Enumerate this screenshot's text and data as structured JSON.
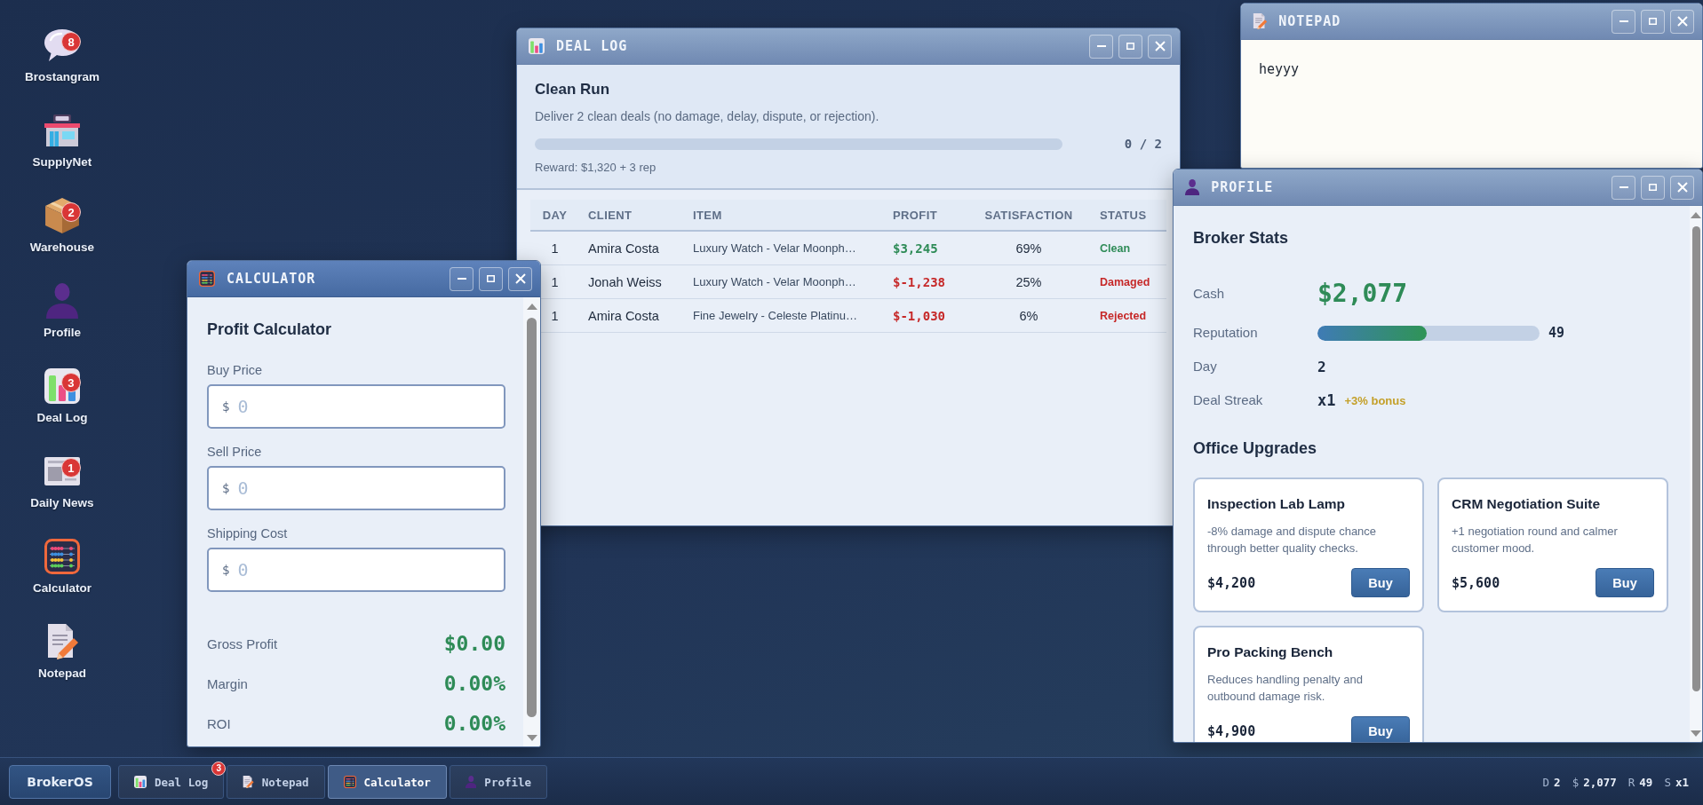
{
  "desktop_icons": [
    {
      "label": "Brostangram",
      "badge": "8"
    },
    {
      "label": "SupplyNet"
    },
    {
      "label": "Warehouse",
      "badge": "2"
    },
    {
      "label": "Profile"
    },
    {
      "label": "Deal Log",
      "badge": "3"
    },
    {
      "label": "Daily News",
      "badge": "1"
    },
    {
      "label": "Calculator"
    },
    {
      "label": "Notepad"
    }
  ],
  "deal_log_window": {
    "title": "DEAL LOG",
    "active": false,
    "goal": {
      "title": "Clean Run",
      "description": "Deliver 2 clean deals (no damage, delay, dispute, or rejection).",
      "progress": "0 / 2",
      "reward": "Reward: $1,320 + 3 rep"
    },
    "table": {
      "columns": [
        "DAY",
        "CLIENT",
        "ITEM",
        "PROFIT",
        "SATISFACTION",
        "STATUS"
      ],
      "rows": [
        {
          "day": "1",
          "client": "Amira Costa",
          "item": "Luxury Watch - Velar Moonph…",
          "profit": {
            "text": "$3,245",
            "color": "#2e8b57"
          },
          "satisfaction": "69%",
          "status": {
            "text": "Clean",
            "color": "#2e8b57"
          }
        },
        {
          "day": "1",
          "client": "Jonah Weiss",
          "item": "Luxury Watch - Velar Moonph…",
          "profit": {
            "text": "$-1,238",
            "color": "#c62828"
          },
          "satisfaction": "25%",
          "status": {
            "text": "Damaged",
            "color": "#c62828"
          }
        },
        {
          "day": "1",
          "client": "Amira Costa",
          "item": "Fine Jewelry - Celeste Platinu…",
          "profit": {
            "text": "$-1,030",
            "color": "#c62828"
          },
          "satisfaction": "6%",
          "status": {
            "text": "Rejected",
            "color": "#c62828"
          }
        }
      ]
    }
  },
  "calculator_window": {
    "title": "CALCULATOR",
    "active": true,
    "heading": "Profit Calculator",
    "fields": [
      {
        "label": "Buy Price",
        "prefix": "$",
        "placeholder": "0"
      },
      {
        "label": "Sell Price",
        "prefix": "$",
        "placeholder": "0"
      },
      {
        "label": "Shipping Cost",
        "prefix": "$",
        "placeholder": "0"
      }
    ],
    "results": [
      {
        "label": "Gross Profit",
        "value": "$0.00"
      },
      {
        "label": "Margin",
        "value": "0.00%"
      },
      {
        "label": "ROI",
        "value": "0.00%"
      }
    ]
  },
  "notepad_window": {
    "title": "NOTEPAD",
    "active": false,
    "text": "heyyy"
  },
  "profile_window": {
    "title": "PROFILE",
    "active": false,
    "heading": "Broker Stats",
    "stats": [
      {
        "kind": "cash",
        "label": "Cash",
        "value": "$2,077"
      },
      {
        "kind": "meter",
        "label": "Reputation",
        "level": 0.49,
        "value": "49"
      },
      {
        "kind": "plain",
        "label": "Day",
        "value": "2"
      },
      {
        "kind": "streak",
        "label": "Deal Streak",
        "value": "x1",
        "bonus": "+3% bonus"
      }
    ],
    "upgrades_heading": "Office Upgrades",
    "upgrades": [
      {
        "name": "Inspection Lab Lamp",
        "description": "-8% damage and dispute chance through better quality checks.",
        "price": "$4,200",
        "button": "Buy"
      },
      {
        "name": "CRM Negotiation Suite",
        "description": "+1 negotiation round and calmer customer mood.",
        "price": "$5,600",
        "button": "Buy"
      },
      {
        "name": "Pro Packing Bench",
        "description": "Reduces handling penalty and outbound damage risk.",
        "price": "$4,900",
        "button": "Buy"
      }
    ]
  },
  "taskbar": {
    "start_button": "BrokerOS",
    "items": [
      {
        "label": "Deal Log",
        "badge": "3",
        "selected": false
      },
      {
        "label": "Notepad",
        "selected": false
      },
      {
        "label": "Calculator",
        "selected": true
      },
      {
        "label": "Profile",
        "selected": false
      }
    ],
    "status": [
      {
        "label": "D",
        "value": "2"
      },
      {
        "label": "$",
        "value": "2,077"
      },
      {
        "label": "R",
        "value": "49"
      },
      {
        "label": "S",
        "value": "x1"
      }
    ]
  }
}
